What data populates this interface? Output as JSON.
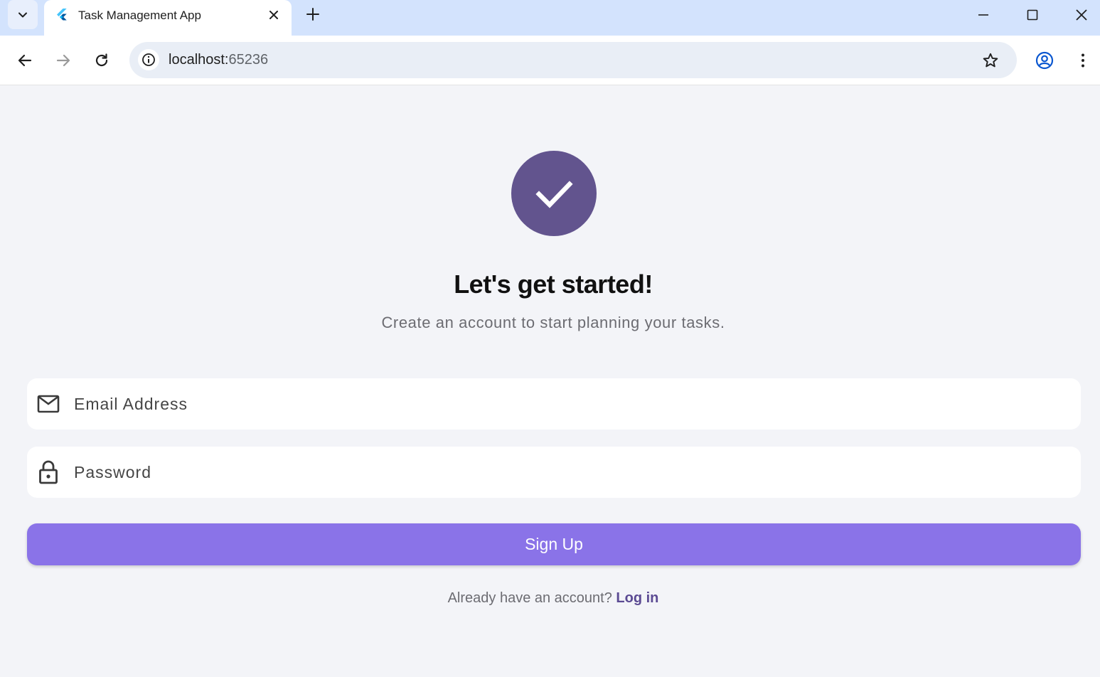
{
  "browser": {
    "tab": {
      "title": "Task Management App"
    },
    "address": {
      "host": "localhost:",
      "port": "65236"
    }
  },
  "colors": {
    "tabstrip": "#d3e3fd",
    "accent_circle": "#62548e",
    "signup_button": "#8a73e8",
    "link": "#5b4a93",
    "page_background": "#f3f4f8"
  },
  "icons": {
    "logo": "checkmark-icon",
    "email": "mail-icon",
    "password": "lock-icon"
  },
  "signup": {
    "headline": "Let's get started!",
    "subtitle": "Create an account to start planning your tasks.",
    "email_placeholder": "Email Address",
    "password_placeholder": "Password",
    "button_label": "Sign Up",
    "footer_prompt": "Already have an account?",
    "login_link": "Log in"
  }
}
